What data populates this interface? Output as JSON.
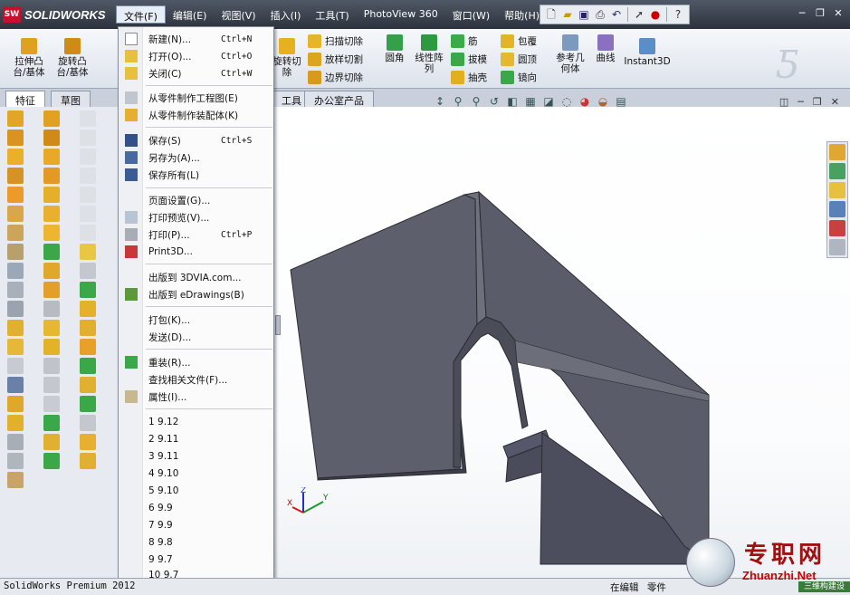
{
  "app": {
    "brand": "SOLIDWORKS",
    "logo_badge": "SW"
  },
  "menubar": [
    "文件(F)",
    "编辑(E)",
    "视图(V)",
    "插入(I)",
    "工具(T)",
    "PhotoView 360",
    "窗口(W)",
    "帮助(H)"
  ],
  "quick_toolbar": {
    "help": "?"
  },
  "ribbon": {
    "extrude_boss": "拉伸凸台/基体",
    "revolve_boss": "旋转凸台/基体",
    "revolve_cut": "旋转切除",
    "swept_cut": "扫描切除",
    "loft_cut": "放样切割",
    "boundary_cut": "边界切除",
    "fillet": "圆角",
    "linear_pattern": "线性阵列",
    "rib": "筋",
    "draft": "拔模",
    "shell": "抽壳",
    "wrap": "包覆",
    "dome": "圆顶",
    "mirror": "镜向",
    "ref_geometry": "参考几何体",
    "curves": "曲线",
    "instant3d": "Instant3D"
  },
  "tabs": [
    "特征",
    "草图",
    "工具",
    "办公室产品"
  ],
  "file_menu": {
    "items": [
      {
        "label": "新建(N)...",
        "shortcut": "Ctrl+N"
      },
      {
        "label": "打开(O)...",
        "shortcut": "Ctrl+O"
      },
      {
        "label": "关闭(C)",
        "shortcut": "Ctrl+W"
      },
      {
        "label": "从零件制作工程图(E)",
        "shortcut": ""
      },
      {
        "label": "从零件制作装配体(K)",
        "shortcut": ""
      },
      {
        "label": "保存(S)",
        "shortcut": "Ctrl+S"
      },
      {
        "label": "另存为(A)...",
        "shortcut": ""
      },
      {
        "label": "保存所有(L)",
        "shortcut": ""
      },
      {
        "label": "页面设置(G)...",
        "shortcut": ""
      },
      {
        "label": "打印预览(V)...",
        "shortcut": ""
      },
      {
        "label": "打印(P)...",
        "shortcut": "Ctrl+P"
      },
      {
        "label": "Print3D...",
        "shortcut": ""
      },
      {
        "label": "出版到 3DVIA.com...",
        "shortcut": ""
      },
      {
        "label": "出版到 eDrawings(B)",
        "shortcut": ""
      },
      {
        "label": "打包(K)...",
        "shortcut": ""
      },
      {
        "label": "发送(D)...",
        "shortcut": ""
      },
      {
        "label": "重装(R)...",
        "shortcut": ""
      },
      {
        "label": "查找相关文件(F)...",
        "shortcut": ""
      },
      {
        "label": "属性(I)...",
        "shortcut": ""
      }
    ],
    "recent": [
      "1 9.12",
      "2 9.11",
      "3 9.11",
      "4 9.10",
      "5 9.10",
      "6 9.9",
      "7 9.9",
      "8 9.8",
      "9 9.7",
      "10 9.7"
    ]
  },
  "triad": {
    "x": "X",
    "y": "Y",
    "z": "Z"
  },
  "status": {
    "product": "SolidWorks Premium 2012",
    "mode": "在编辑",
    "doc": "零件"
  },
  "watermark": {
    "cn": "专职网",
    "url": "Zhuanzhi.Net",
    "strip": "三维构建设"
  },
  "colors": {
    "accent": "#c8102e",
    "part_face": "#5d5f6c",
    "part_face_dark": "#464855",
    "part_edge": "#2a2b33"
  }
}
